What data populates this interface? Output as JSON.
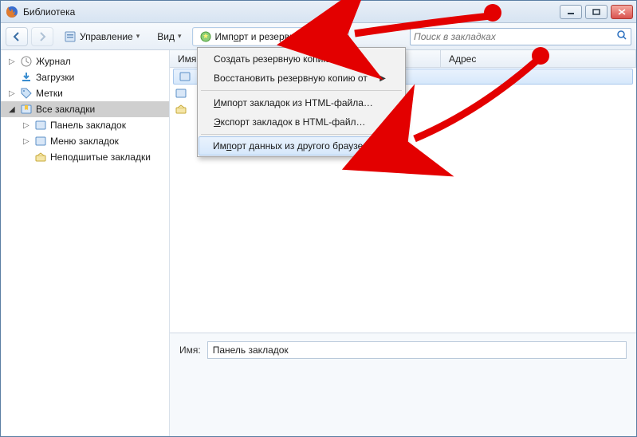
{
  "window": {
    "title": "Библиотека"
  },
  "toolbar": {
    "manage": "Управление",
    "view": "Вид",
    "import": "Импорт и резервные копии"
  },
  "search": {
    "placeholder": "Поиск в закладках"
  },
  "sidebar": {
    "history": "Журнал",
    "downloads": "Загрузки",
    "tags": "Метки",
    "all_bookmarks": "Все закладки",
    "toolbar_bookmarks": "Панель закладок",
    "menu_bookmarks": "Меню закладок",
    "unsorted_bookmarks": "Неподшитые закладки"
  },
  "columns": {
    "name": "Имя",
    "address": "Адрес"
  },
  "detail": {
    "name_label": "Имя:",
    "name_value": "Панель закладок"
  },
  "menu": {
    "create_backup": "Создать резервную копию…",
    "restore_backup": "Восстановить резервную копию от",
    "import_html": "Импорт закладок из HTML-файла…",
    "export_html": "Экспорт закладок в HTML-файл…",
    "import_browser": "Импорт данных из другого браузера…"
  }
}
